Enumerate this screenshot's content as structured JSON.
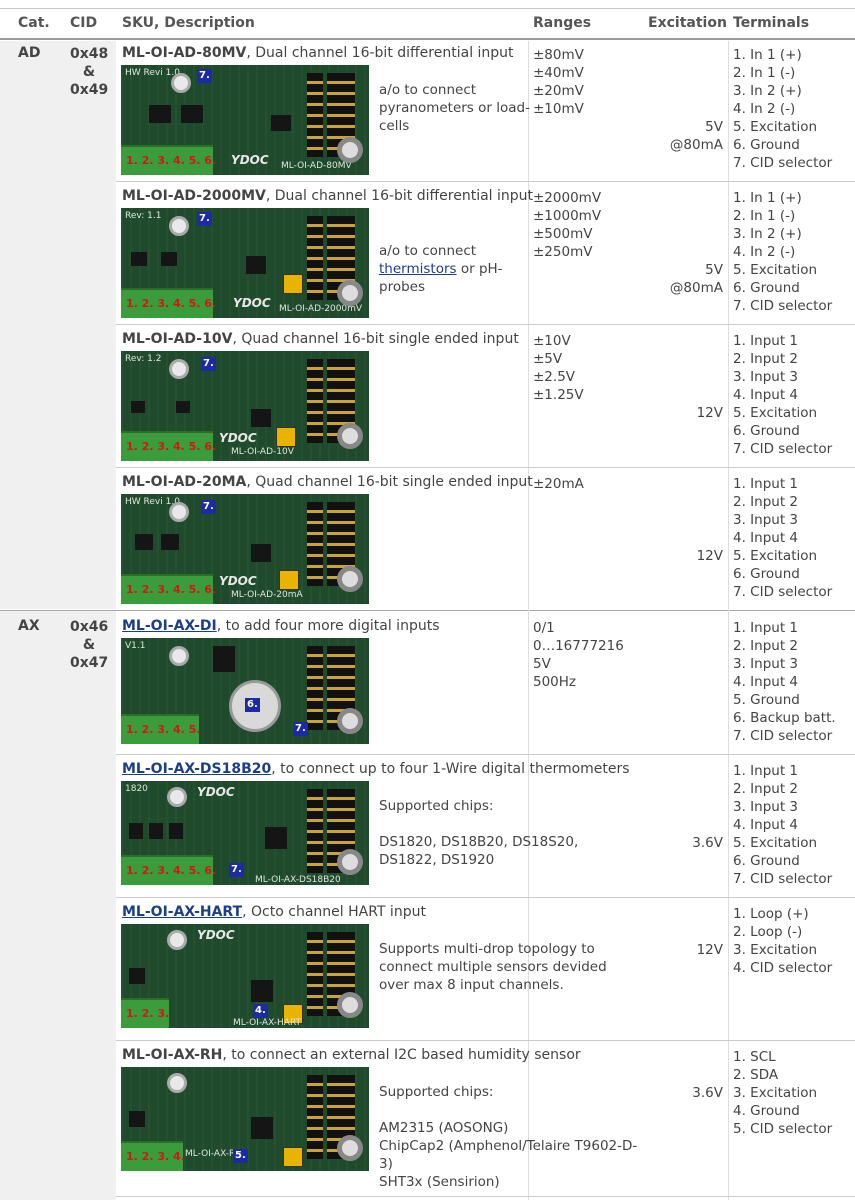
{
  "header": {
    "cat": "Cat.",
    "cid": "CID",
    "sku": "SKU, Description",
    "ranges": "Ranges",
    "excitation": "Excitation",
    "terminals": "Terminals"
  },
  "categories": [
    {
      "cat": "AD",
      "cid": [
        "0x48",
        "&",
        "0x49"
      ]
    },
    {
      "cat": "AX",
      "cid": [
        "0x46",
        "&",
        "0x47"
      ]
    }
  ],
  "rows": [
    {
      "sku": "ML-OI-AD-80MV",
      "desc": ", Dual channel 16-bit differential input",
      "note": "a/o to connect pyranometers or load-cells",
      "ranges": [
        "±80mV",
        "±40mV",
        "±20mV",
        "±10mV"
      ],
      "excitation": [
        "5V",
        "@80mA"
      ],
      "terminals": [
        "1. In 1 (+)",
        "2. In 1 (-)",
        "3. In 2 (+)",
        "4. In 2 (-)",
        "5. Excitation",
        "6. Ground",
        "7. CID selector"
      ],
      "board": {
        "rev": "HW Revi 1.0",
        "pins": "1. 2. 3. 4. 5. 6.",
        "badge": "7.",
        "brand": "YDOC",
        "name": "ML-OI-AD-80MV"
      }
    },
    {
      "sku": "ML-OI-AD-2000MV",
      "desc": ", Dual channel 16-bit differential input",
      "note_pre": "a/o to connect",
      "note_link": "thermistors",
      "note_post": "or pH-probes",
      "ranges": [
        "±2000mV",
        "±1000mV",
        "±500mV",
        "±250mV"
      ],
      "excitation": [
        "5V",
        "@80mA"
      ],
      "terminals": [
        "1. In 1 (+)",
        "2. In 1 (-)",
        "3. In 2 (+)",
        "4. In 2 (-)",
        "5. Excitation",
        "6. Ground",
        "7. CID selector"
      ],
      "board": {
        "rev": "Rev: 1.1",
        "pins": "1. 2. 3. 4. 5. 6.",
        "badge": "7.",
        "brand": "YDOC",
        "name": "ML-OI-AD-2000mV"
      }
    },
    {
      "sku": "ML-OI-AD-10V",
      "desc": ", Quad channel 16-bit single ended input",
      "ranges": [
        "±10V",
        "±5V",
        "±2.5V",
        "±1.25V"
      ],
      "excitation": [
        "12V"
      ],
      "terminals": [
        "1. Input 1",
        "2. Input 2",
        "3. Input 3",
        "4. Input 4",
        "5. Excitation",
        "6. Ground",
        "7. CID selector"
      ],
      "board": {
        "rev": "Rev: 1.2",
        "pins": "1. 2. 3. 4. 5. 6.",
        "badge": "7.",
        "brand": "YDOC",
        "name": "ML-OI-AD-10V"
      }
    },
    {
      "sku": "ML-OI-AD-20MA",
      "desc": ", Quad channel 16-bit single ended input",
      "ranges": [
        "±20mA"
      ],
      "excitation": [
        "12V"
      ],
      "terminals": [
        "1. Input 1",
        "2. Input 2",
        "3. Input 3",
        "4. Input 4",
        "5. Excitation",
        "6. Ground",
        "7. CID selector"
      ],
      "board": {
        "rev": "HW Revi 1.0",
        "pins": "1. 2. 3. 4. 5. 6.",
        "badge": "7.",
        "brand": "YDOC",
        "name": "ML-OI-AD-20mA"
      }
    },
    {
      "sku": "ML-OI-AX-DI",
      "desc": ", to add four more digital inputs",
      "ranges": [
        "0/1",
        "0…16777216",
        "5V",
        "500Hz"
      ],
      "excitation": [],
      "terminals": [
        "1. Input 1",
        "2. Input 2",
        "3. Input 3",
        "4. Input 4",
        "5. Ground",
        "6. Backup batt.",
        "7. CID selector"
      ],
      "board": {
        "rev": "V1.1",
        "pins": "1. 2. 3. 4. 5.",
        "badge": "7.",
        "badge2": "6.",
        "brand": "",
        "name": ""
      }
    },
    {
      "sku": "ML-OI-AX-DS18B20",
      "desc": ", to connect up to four 1-Wire digital thermometers",
      "note_title": "Supported chips:",
      "note_body": "DS1820, DS18B20, DS18S20, DS1822, DS1920",
      "ranges": [],
      "excitation": [
        "3.6V"
      ],
      "terminals": [
        "1. Input 1",
        "2. Input 2",
        "3. Input 3",
        "4. Input 4",
        "5. Excitation",
        "6. Ground",
        "7. CID selector"
      ],
      "board": {
        "rev": "1820",
        "pins": "1. 2. 3. 4. 5. 6.",
        "badge": "7.",
        "brand": "YDOC",
        "name": "ML-OI-AX-DS18B20"
      }
    },
    {
      "sku": "ML-OI-AX-HART",
      "desc": ", Octo channel HART input",
      "note": "Supports multi-drop topology to connect multiple sensors devided over max 8 input channels.",
      "ranges": [],
      "excitation": [
        "12V"
      ],
      "terminals": [
        "1. Loop (+)",
        "2. Loop (-)",
        "3. Excitation",
        "4. CID selector"
      ],
      "board": {
        "rev": "",
        "pins": "1. 2. 3.",
        "badge": "4.",
        "brand": "YDOC",
        "name": "ML-OI-AX-HART"
      }
    },
    {
      "sku": "ML-OI-AX-RH",
      "desc": ", to connect an external I2C based humidity sensor",
      "note_title": "Supported chips:",
      "note_lines": [
        "AM2315 (AOSONG)",
        "ChipCap2 (Amphenol/Telaire T9602-D-3)",
        "SHT3x (Sensirion)"
      ],
      "ranges": [],
      "excitation": [
        "3.6V"
      ],
      "terminals": [
        "1. SCL",
        "2. SDA",
        "3. Excitation",
        "4. Ground",
        "5. CID selector"
      ],
      "board": {
        "rev": "",
        "pins": "1. 2. 3. 4.",
        "badge": "5.",
        "brand": "YDOC",
        "name": "ML-OI-AX-RH"
      }
    }
  ]
}
